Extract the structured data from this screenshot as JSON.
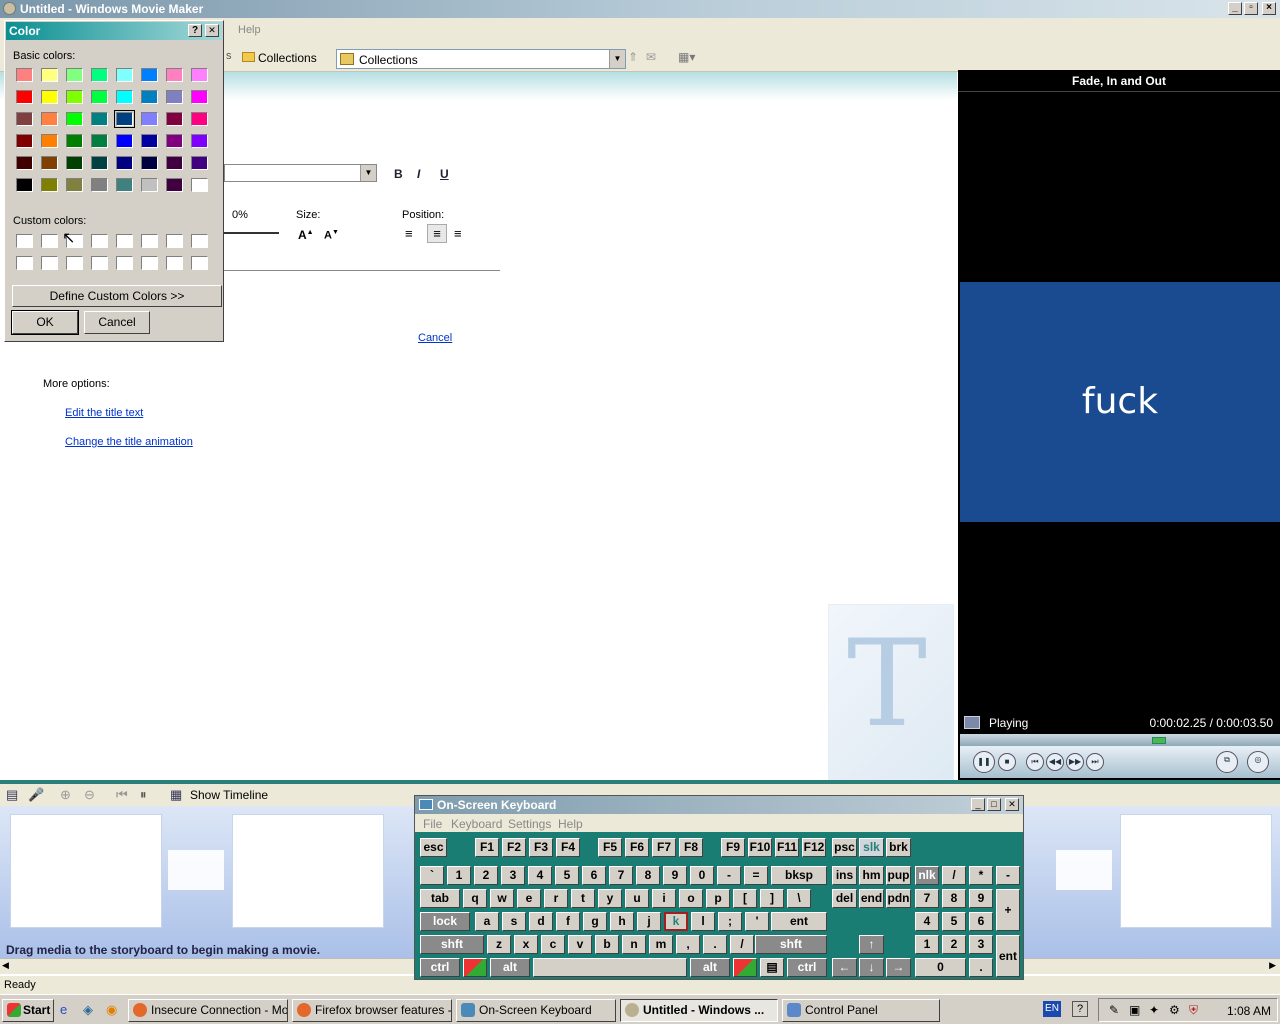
{
  "window": {
    "title": "Untitled - Windows Movie Maker"
  },
  "menu": {
    "help": "Help"
  },
  "toolbar": {
    "collections_btn": "Collections",
    "collections_combo": "Collections"
  },
  "title_editor": {
    "bold": "B",
    "italic": "I",
    "underline": "U",
    "transparency_value": "0%",
    "size_label": "Size:",
    "position_label": "Position:",
    "cancel_link": "Cancel",
    "more_options": "More options:",
    "edit_title_link": "Edit the title text",
    "change_animation_link": "Change the title animation"
  },
  "preview": {
    "title": "Fade, In and Out",
    "text": "fuck",
    "status": "Playing",
    "time": "0:00:02.25 / 0:00:03.50",
    "progress": 0.64
  },
  "timeline": {
    "show_timeline": "Show Timeline",
    "hint": "Drag media to the storyboard to begin making a movie."
  },
  "statusbar": {
    "text": "Ready"
  },
  "color_dialog": {
    "title": "Color",
    "help": "?",
    "close": "✕",
    "basic_colors_label": "Basic colors:",
    "custom_colors_label": "Custom colors:",
    "define_custom": "Define Custom Colors >>",
    "ok": "OK",
    "cancel": "Cancel",
    "basic_colors": [
      [
        "#ff8080",
        "#ffff80",
        "#80ff80",
        "#00ff80",
        "#80ffff",
        "#0080ff",
        "#ff80c0",
        "#ff80ff"
      ],
      [
        "#ff0000",
        "#ffff00",
        "#80ff00",
        "#00ff40",
        "#00ffff",
        "#0080c0",
        "#8080c0",
        "#ff00ff"
      ],
      [
        "#804040",
        "#ff8040",
        "#00ff00",
        "#008080",
        "#004080",
        "#8080ff",
        "#800040",
        "#ff0080"
      ],
      [
        "#800000",
        "#ff8000",
        "#008000",
        "#008040",
        "#0000ff",
        "#0000a0",
        "#800080",
        "#8000ff"
      ],
      [
        "#400000",
        "#804000",
        "#004000",
        "#004040",
        "#000080",
        "#000040",
        "#400040",
        "#400080"
      ],
      [
        "#000000",
        "#808000",
        "#808040",
        "#808080",
        "#408080",
        "#c0c0c0",
        "#400040",
        "#ffffff"
      ]
    ],
    "selected_color": "#004080"
  },
  "osk": {
    "title": "On-Screen Keyboard",
    "menu": [
      "File",
      "Keyboard",
      "Settings",
      "Help"
    ],
    "row1": [
      "esc",
      "F1",
      "F2",
      "F3",
      "F4",
      "F5",
      "F6",
      "F7",
      "F8",
      "F9",
      "F10",
      "F11",
      "F12",
      "psc",
      "slk",
      "brk"
    ],
    "row2": [
      "`",
      "1",
      "2",
      "3",
      "4",
      "5",
      "6",
      "7",
      "8",
      "9",
      "0",
      "-",
      "=",
      "bksp",
      "ins",
      "hm",
      "pup",
      "nlk",
      "/",
      "*",
      "-"
    ],
    "row3": [
      "tab",
      "q",
      "w",
      "e",
      "r",
      "t",
      "y",
      "u",
      "i",
      "o",
      "p",
      "[",
      "]",
      "\\",
      "del",
      "end",
      "pdn",
      "7",
      "8",
      "9",
      "+"
    ],
    "row4": [
      "lock",
      "a",
      "s",
      "d",
      "f",
      "g",
      "h",
      "j",
      "k",
      "l",
      ";",
      "'",
      "ent",
      "4",
      "5",
      "6"
    ],
    "row5": [
      "shft",
      "z",
      "x",
      "c",
      "v",
      "b",
      "n",
      "m",
      ",",
      ".",
      "/",
      "shft",
      "1",
      "2",
      "3",
      "ent"
    ],
    "row6": [
      "ctrl",
      "alt",
      "alt",
      "ctrl",
      "0",
      "."
    ],
    "arrows": [
      "↑",
      "←",
      "↓",
      "→"
    ]
  },
  "taskbar": {
    "start": "Start",
    "tasks": [
      "Insecure Connection - Mo...",
      "Firefox browser features - ...",
      "On-Screen Keyboard",
      "Untitled - Windows ...",
      "Control Panel"
    ],
    "lang": "EN",
    "clock": "1:08 AM"
  }
}
